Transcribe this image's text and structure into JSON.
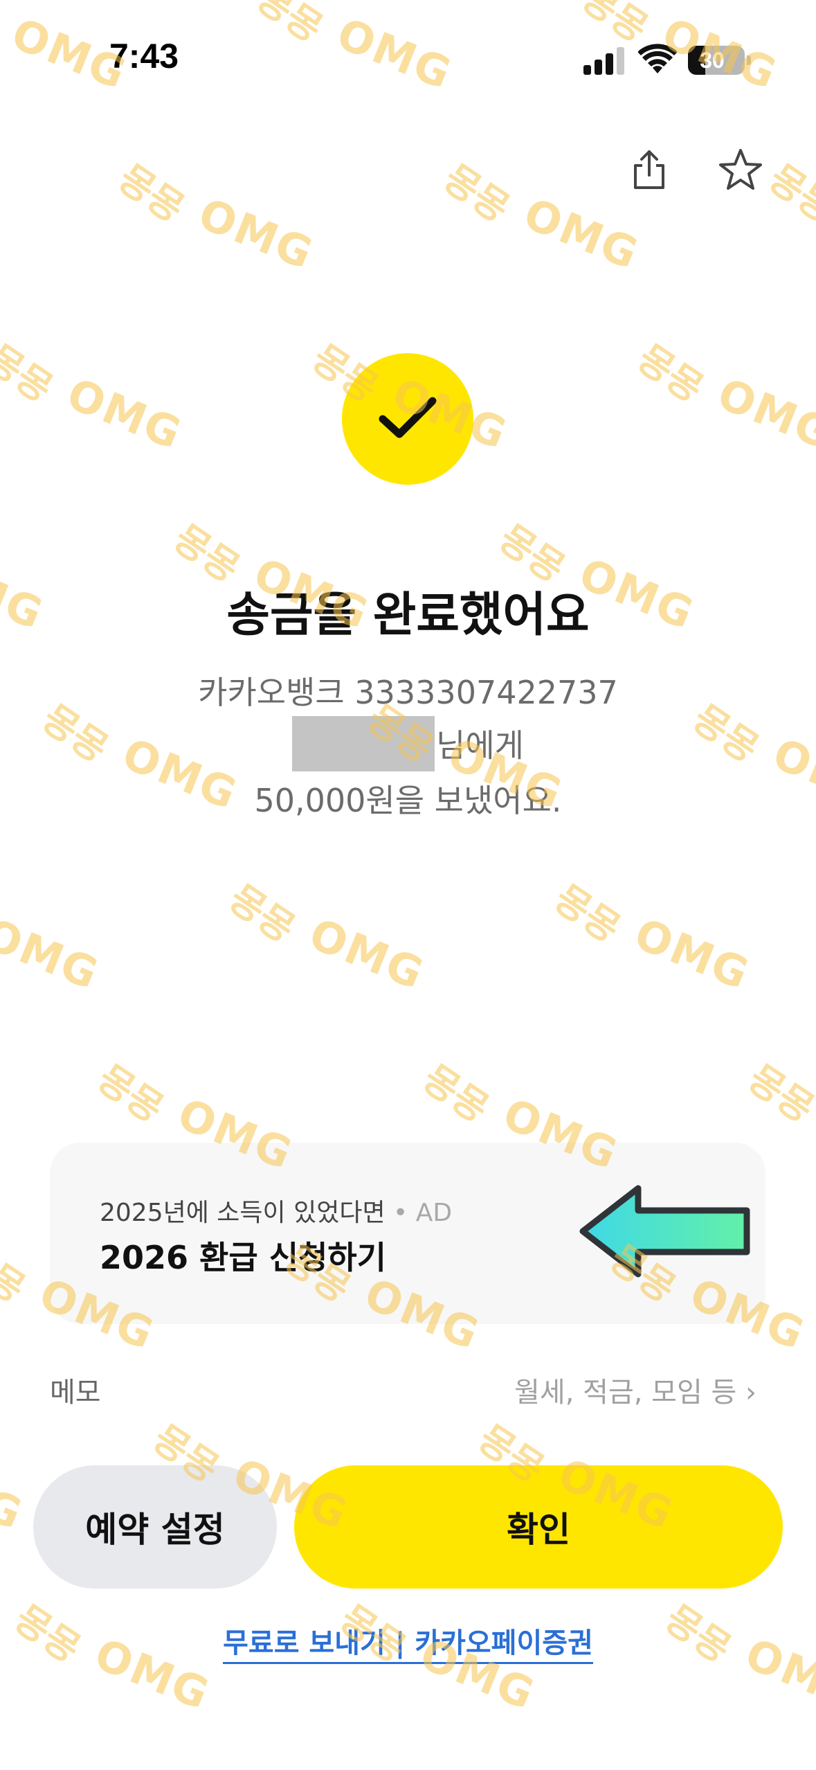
{
  "status_bar": {
    "time": "7:43",
    "battery": "30",
    "battery_level": 0.3,
    "icons": [
      "signal-icon",
      "wifi-icon",
      "battery-icon"
    ]
  },
  "header": {
    "actions": [
      "share-icon",
      "star-icon"
    ]
  },
  "success": {
    "icon": "check-icon",
    "title": "송금을 완료했어요",
    "bank_account": "카카오뱅크 3333307422737",
    "recipient_suffix": "님에게",
    "amount_message": "50,000원을 보냈어요."
  },
  "ad_card": {
    "subtitle": "2025년에 소득이 있었다면",
    "ad_marker": " • AD",
    "title": "2026 환급 신청하기",
    "arrow_icon": "left-arrow-icon"
  },
  "memo": {
    "label": "메모",
    "placeholder": "월세, 적금, 모임 등 ›"
  },
  "buttons": {
    "schedule": "예약 설정",
    "confirm": "확인"
  },
  "footer": {
    "link": "무료로 보내기 | 카카오페이증권"
  },
  "watermark": {
    "korean": "몽몽",
    "english": "OMG"
  },
  "colors": {
    "accent_yellow": "#ffe600",
    "watermark": "#f6c450",
    "link_blue": "#2a6fd6",
    "arrow_cyan": "#3fd8e6",
    "arrow_green": "#63f0a8"
  }
}
